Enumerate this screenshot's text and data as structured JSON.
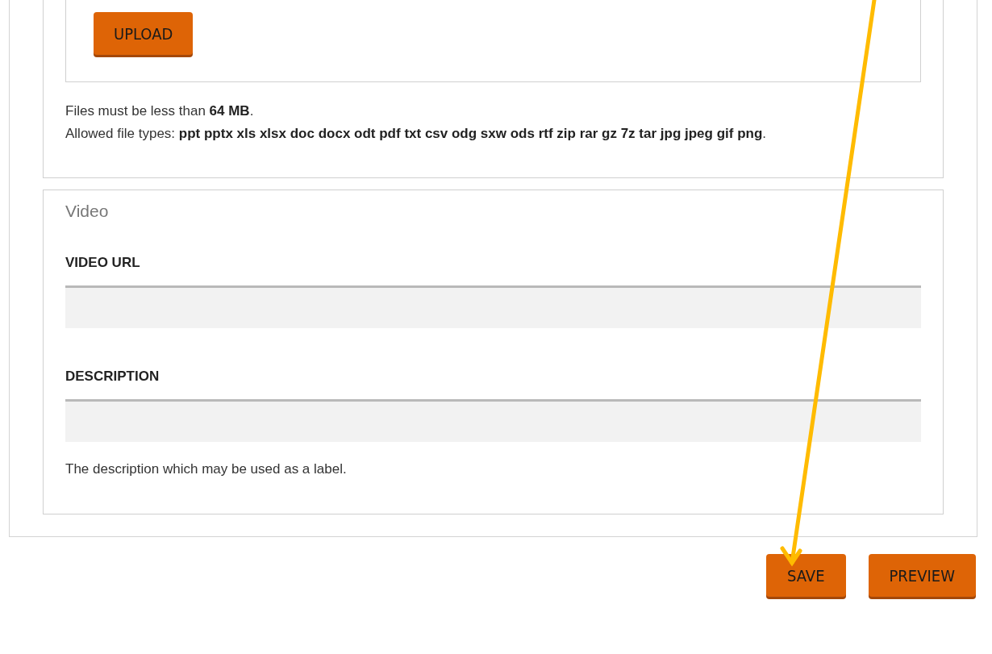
{
  "upload": {
    "button": "UPLOAD"
  },
  "file_rules": [
    "Files must be less than **64 MB**.",
    "Allowed file types: **ppt pptx xls xlsx doc docx odt pdf txt csv odg sxw ods rtf zip rar gz 7z tar jpg jpeg gif png**."
  ],
  "video": {
    "legend": "Video",
    "fields": [
      {
        "label": "VIDEO URL"
      },
      {
        "label": "DESCRIPTION",
        "help": "The description which may be used as a label."
      }
    ]
  },
  "buttons": [
    "SAVE",
    "PREVIEW"
  ],
  "annotation": {
    "kind": "arrow",
    "color": "#ffbb00"
  }
}
